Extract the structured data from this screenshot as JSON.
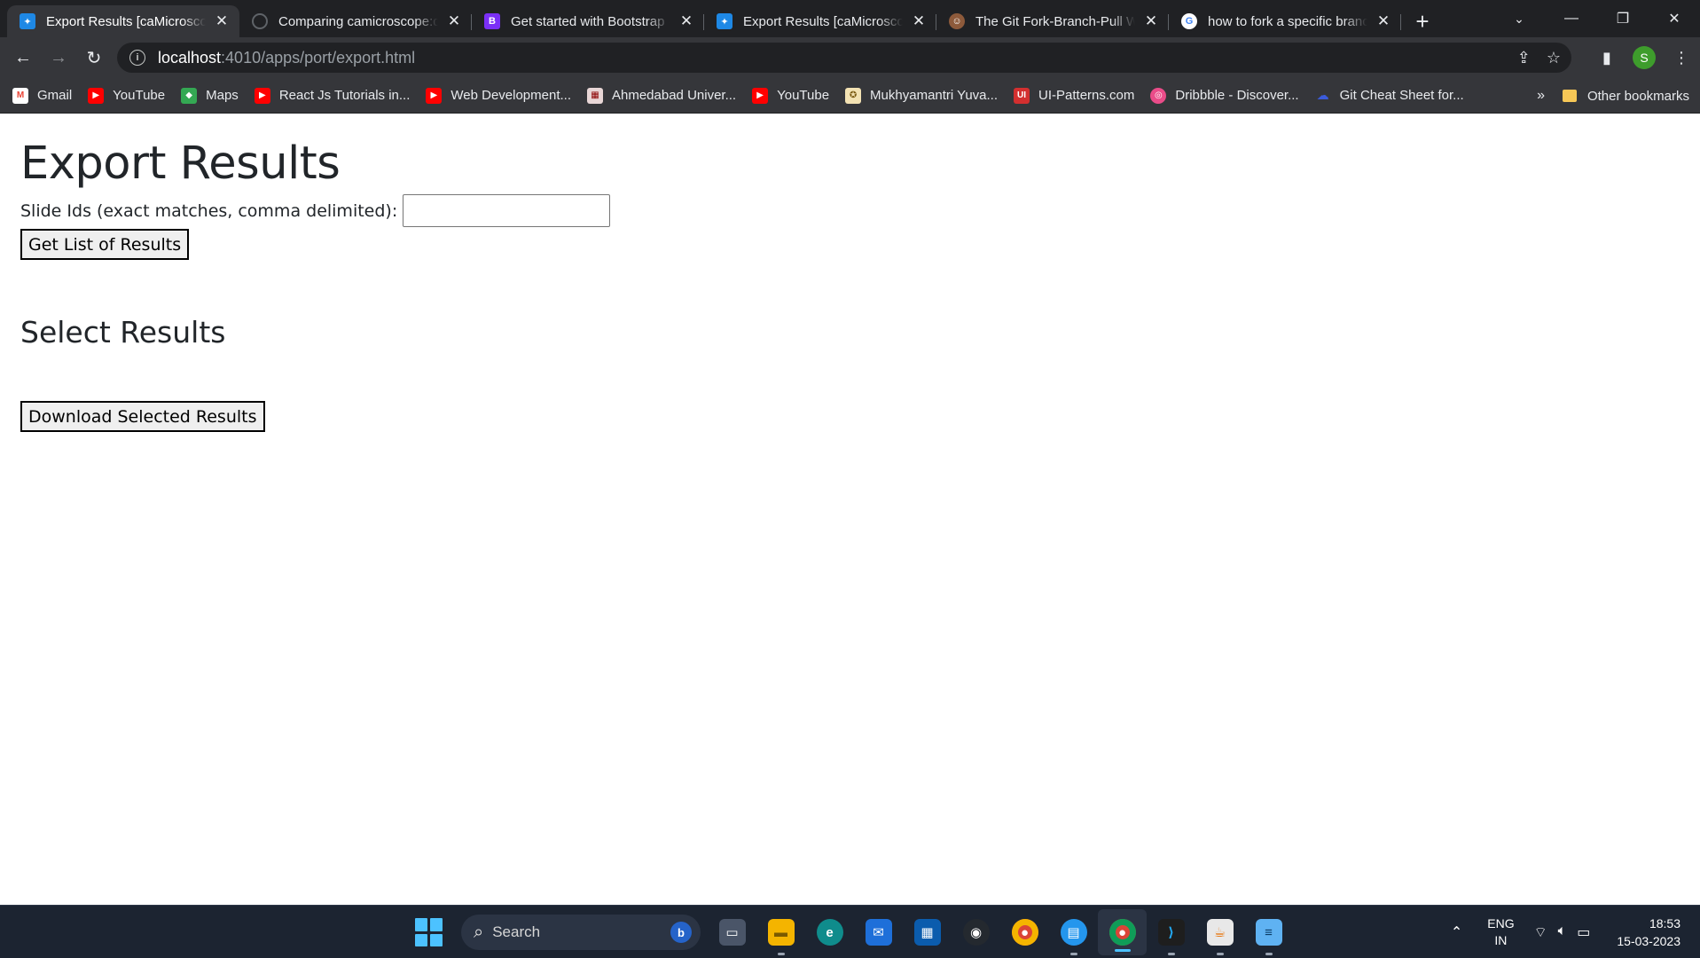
{
  "browser": {
    "tabs": [
      {
        "title": "Export Results [caMicroscope]",
        "favicon": "camicroscope-icon",
        "active": true
      },
      {
        "title": "Comparing camicroscope:develop",
        "favicon": "github-icon",
        "active": false
      },
      {
        "title": "Get started with Bootstrap · Bootstrap",
        "favicon": "bootstrap-icon",
        "active": false
      },
      {
        "title": "Export Results [caMicroscope]",
        "favicon": "camicroscope-icon",
        "active": false
      },
      {
        "title": "The Git Fork-Branch-Pull Workflow",
        "favicon": "avatar-icon",
        "active": false
      },
      {
        "title": "how to fork a specific branch",
        "favicon": "google-icon",
        "active": false
      }
    ],
    "url": {
      "host": "localhost",
      "path": ":4010/apps/port/export.html"
    },
    "profile_initial": "S",
    "bookmarks": [
      {
        "label": "Gmail",
        "icon": "gmail-icon"
      },
      {
        "label": "YouTube",
        "icon": "youtube-icon"
      },
      {
        "label": "Maps",
        "icon": "maps-icon"
      },
      {
        "label": "React Js Tutorials in...",
        "icon": "youtube-icon"
      },
      {
        "label": "Web Development...",
        "icon": "youtube-icon"
      },
      {
        "label": "Ahmedabad Univer...",
        "icon": "university-icon"
      },
      {
        "label": "YouTube",
        "icon": "youtube-icon"
      },
      {
        "label": "Mukhyamantri Yuva...",
        "icon": "emblem-icon"
      },
      {
        "label": "UI-Patterns.com",
        "icon": "ui-patterns-icon"
      },
      {
        "label": "Dribbble - Discover...",
        "icon": "dribbble-icon"
      },
      {
        "label": "Git Cheat Sheet for...",
        "icon": "cloud-icon"
      }
    ],
    "more_bookmarks": "»",
    "other_bookmarks": "Other bookmarks"
  },
  "page": {
    "heading": "Export Results",
    "slide_ids_label": "Slide Ids (exact matches, comma delimited):",
    "slide_ids_value": "",
    "get_results_button": "Get List of Results",
    "select_heading": "Select Results",
    "download_button": "Download Selected Results"
  },
  "taskbar": {
    "search_placeholder": "Search",
    "language": "ENG",
    "region": "IN",
    "time": "18:53",
    "date": "15-03-2023"
  },
  "colors": {
    "tabstrip_bg": "#202124",
    "toolbar_bg": "#35363a",
    "taskbar_bg": "#1c2431",
    "accent": "#4cc2ff"
  }
}
